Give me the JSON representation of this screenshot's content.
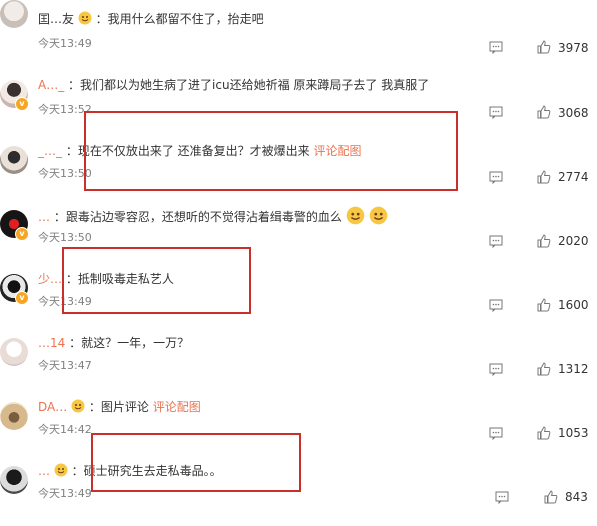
{
  "comments": [
    {
      "user": "囯…友",
      "text": "：我用什么都留不住了，抬走吧",
      "time": "今天13:49",
      "likes": "3978"
    },
    {
      "user": "A…_",
      "text": "：我们都以为她生病了进了icu还给她祈福 原来蹲局子去了 我真服了",
      "time": "今天13:52",
      "likes": "3068"
    },
    {
      "user": "_…_",
      "text": "：现在不仅放出来了 还准备复出？才被爆出来",
      "link": "评论配图",
      "time": "今天13:50",
      "likes": "2774"
    },
    {
      "user": "…",
      "text": "：跟毒沾边零容忍，还想听的不觉得沾着缉毒警的血么",
      "time": "今天13:50",
      "likes": "2020"
    },
    {
      "user": "少…",
      "text": "：抵制吸毒走私艺人",
      "time": "今天13:49",
      "likes": "1600"
    },
    {
      "user": "…14",
      "text": "：就这？一年，一万？",
      "time": "今天13:47",
      "likes": "1312"
    },
    {
      "user": "DA…",
      "text": "：图片评论",
      "link": "评论配图",
      "time": "今天14:42",
      "likes": "1053"
    },
    {
      "user": "…",
      "text": "：硕士研究生去走私毒品。。",
      "time": "今天13:49",
      "likes": "843"
    }
  ],
  "colors": {
    "accent": "#eb7350",
    "highlight": "#c9302c",
    "meta": "#808080"
  },
  "icons": [
    "comment-icon",
    "thumbs-up-icon",
    "verified-badge-icon",
    "smile-emoji-icon"
  ]
}
